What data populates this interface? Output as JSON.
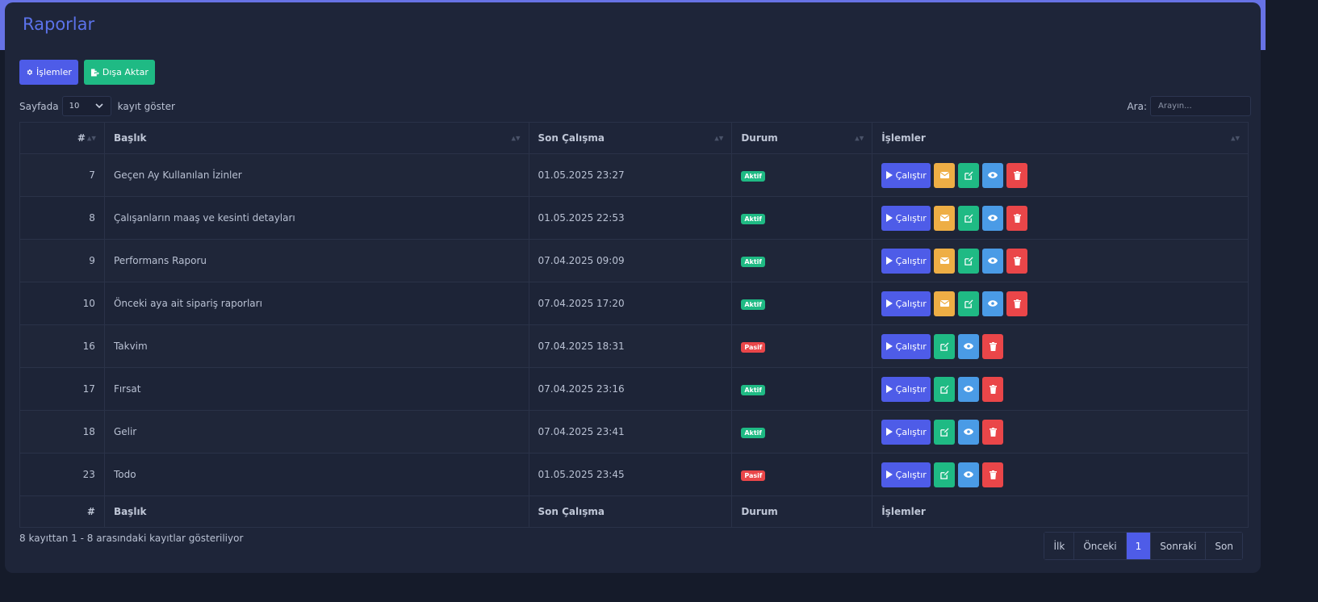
{
  "page": {
    "title": "Raporlar"
  },
  "toolbar": {
    "operations_label": "İşlemler",
    "export_label": "Dışa Aktar"
  },
  "length": {
    "prefix": "Sayfada",
    "value": "10",
    "suffix": "kayıt göster"
  },
  "search": {
    "label": "Ara:",
    "placeholder": "Arayın..."
  },
  "table": {
    "columns": [
      "#",
      "Başlık",
      "Son Çalışma",
      "Durum",
      "İşlemler"
    ],
    "rows": [
      {
        "id": "7",
        "title": "Geçen Ay Kullanılan İzinler",
        "last_run": "01.05.2025 23:27",
        "status": "Aktif"
      },
      {
        "id": "8",
        "title": "Çalışanların maaş ve kesinti detayları",
        "last_run": "01.05.2025 22:53",
        "status": "Aktif"
      },
      {
        "id": "9",
        "title": "Performans Raporu",
        "last_run": "07.04.2025 09:09",
        "status": "Aktif"
      },
      {
        "id": "10",
        "title": "Önceki aya ait sipariş raporları",
        "last_run": "07.04.2025 17:20",
        "status": "Aktif"
      },
      {
        "id": "16",
        "title": "Takvim",
        "last_run": "07.04.2025 18:31",
        "status": "Pasif"
      },
      {
        "id": "17",
        "title": "Fırsat",
        "last_run": "07.04.2025 23:16",
        "status": "Aktif"
      },
      {
        "id": "18",
        "title": "Gelir",
        "last_run": "07.04.2025 23:41",
        "status": "Aktif"
      },
      {
        "id": "23",
        "title": "Todo",
        "last_run": "01.05.2025 23:45",
        "status": "Pasif"
      }
    ],
    "run_label": "Çalıştır"
  },
  "info": "8 kayıttan 1 - 8 arasındaki kayıtlar gösteriliyor",
  "pagination": {
    "first": "İlk",
    "previous": "Önceki",
    "current": "1",
    "next": "Sonraki",
    "last": "Son"
  },
  "colors": {
    "accent": "#4e5ce8",
    "success": "#1fba84",
    "danger": "#ea4649",
    "warning": "#eeae45",
    "info": "#4a9be6"
  }
}
